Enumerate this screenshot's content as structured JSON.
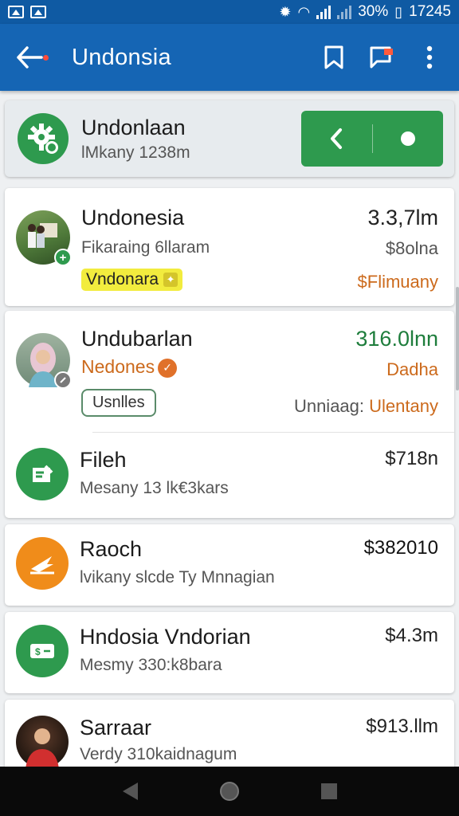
{
  "status_bar": {
    "battery_percent": "30%",
    "time": "17245"
  },
  "app_bar": {
    "title": "Undonsia"
  },
  "header": {
    "title": "Undonlaan",
    "subtitle": "lMkany 1238m"
  },
  "items": [
    {
      "name": "Undonesia",
      "sub": "Fikaraing 6llaram",
      "tag": "Vndonara",
      "amount": "3.3,7lm",
      "side": "$8olna",
      "side2": "$Flimuany"
    },
    {
      "name": "Undubarlan",
      "sub": "Nedones",
      "tag": "Usnlles",
      "amount": "316.0lnn",
      "side": "Dadha",
      "side2_label": "Unniaag:",
      "side2_value": "Ulentany"
    },
    {
      "name": "Fileh",
      "sub": "Mesany 13 lk€3kars",
      "amount": "$718n"
    },
    {
      "name": "Raoch",
      "sub": "lvikany slcde Ty Mnnagian",
      "amount": "$382010"
    },
    {
      "name": "Hndosia Vndorian",
      "sub": "Mesmy 330:k8bara",
      "amount": "$4.3m"
    },
    {
      "name": "Sarraar",
      "sub": "Verdy 310kaidnagum",
      "amount": "$913.llm"
    }
  ],
  "colors": {
    "status_bar": "#0f5aa3",
    "app_bar": "#1565b4",
    "green": "#2e9a4e",
    "orange": "#f08c1a",
    "amount_green": "#1e7d3c",
    "side_orange": "#cc6a1c",
    "tag_yellow": "#f2ec3e"
  },
  "icons": {
    "back": "arrow-left-icon",
    "bookmark": "bookmark-icon",
    "flag": "flag-chat-icon",
    "more": "more-vert-icon",
    "header": "gear-icon"
  }
}
